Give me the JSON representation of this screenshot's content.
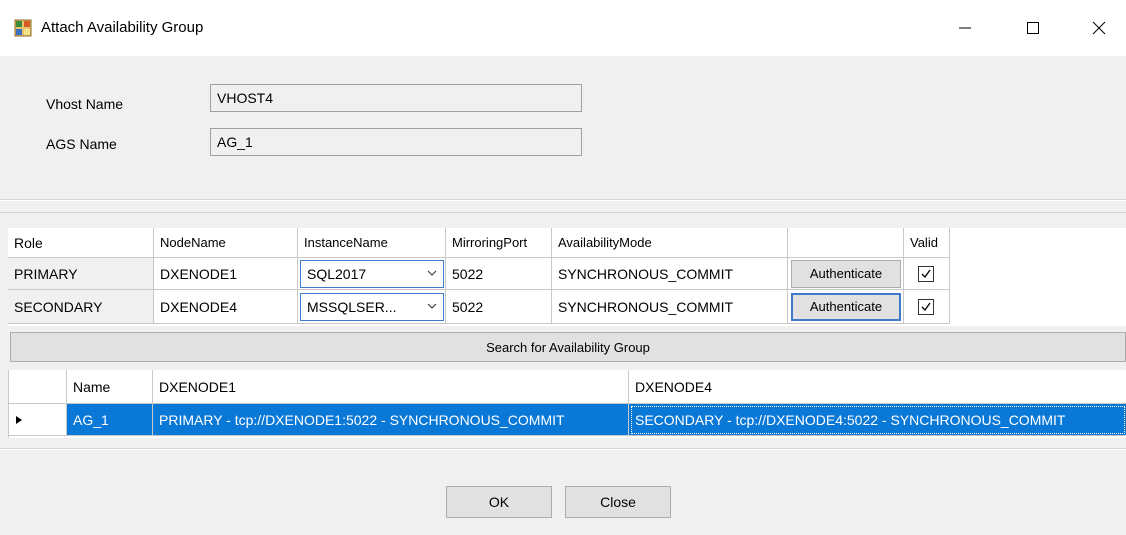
{
  "window": {
    "title": "Attach Availability Group",
    "icon": "grid-app-icon",
    "controls": [
      "minimize-icon",
      "maximize-icon",
      "close-icon"
    ]
  },
  "form": {
    "vhost_label": "Vhost Name",
    "vhost_value": "VHOST4",
    "ags_label": "AGS Name",
    "ags_value": "AG_1"
  },
  "nodes_grid": {
    "headers": [
      "Role",
      "NodeName",
      "InstanceName",
      "MirroringPort",
      "AvailabilityMode",
      "",
      "Valid"
    ],
    "rows": [
      {
        "role": "PRIMARY",
        "node": "DXENODE1",
        "instance": "SQL2017",
        "port": "5022",
        "mode": "SYNCHRONOUS_COMMIT",
        "action": "Authenticate",
        "valid": true
      },
      {
        "role": "SECONDARY",
        "node": "DXENODE4",
        "instance": "MSSQLSER...",
        "port": "5022",
        "mode": "SYNCHRONOUS_COMMIT",
        "action": "Authenticate",
        "valid": true
      }
    ]
  },
  "search_button": "Search for Availability Group",
  "ag_grid": {
    "headers": [
      "",
      "Name",
      "DXENODE1",
      "DXENODE4"
    ],
    "rows": [
      {
        "name": "AG_1",
        "node1": "PRIMARY - tcp://DXENODE1:5022 - SYNCHRONOUS_COMMIT",
        "node4": "SECONDARY - tcp://DXENODE4:5022 - SYNCHRONOUS_COMMIT",
        "selected": true
      }
    ]
  },
  "footer": {
    "ok": "OK",
    "close": "Close"
  },
  "colors": {
    "selection": "#0a78d7",
    "focus_border": "#3d7bc9"
  }
}
